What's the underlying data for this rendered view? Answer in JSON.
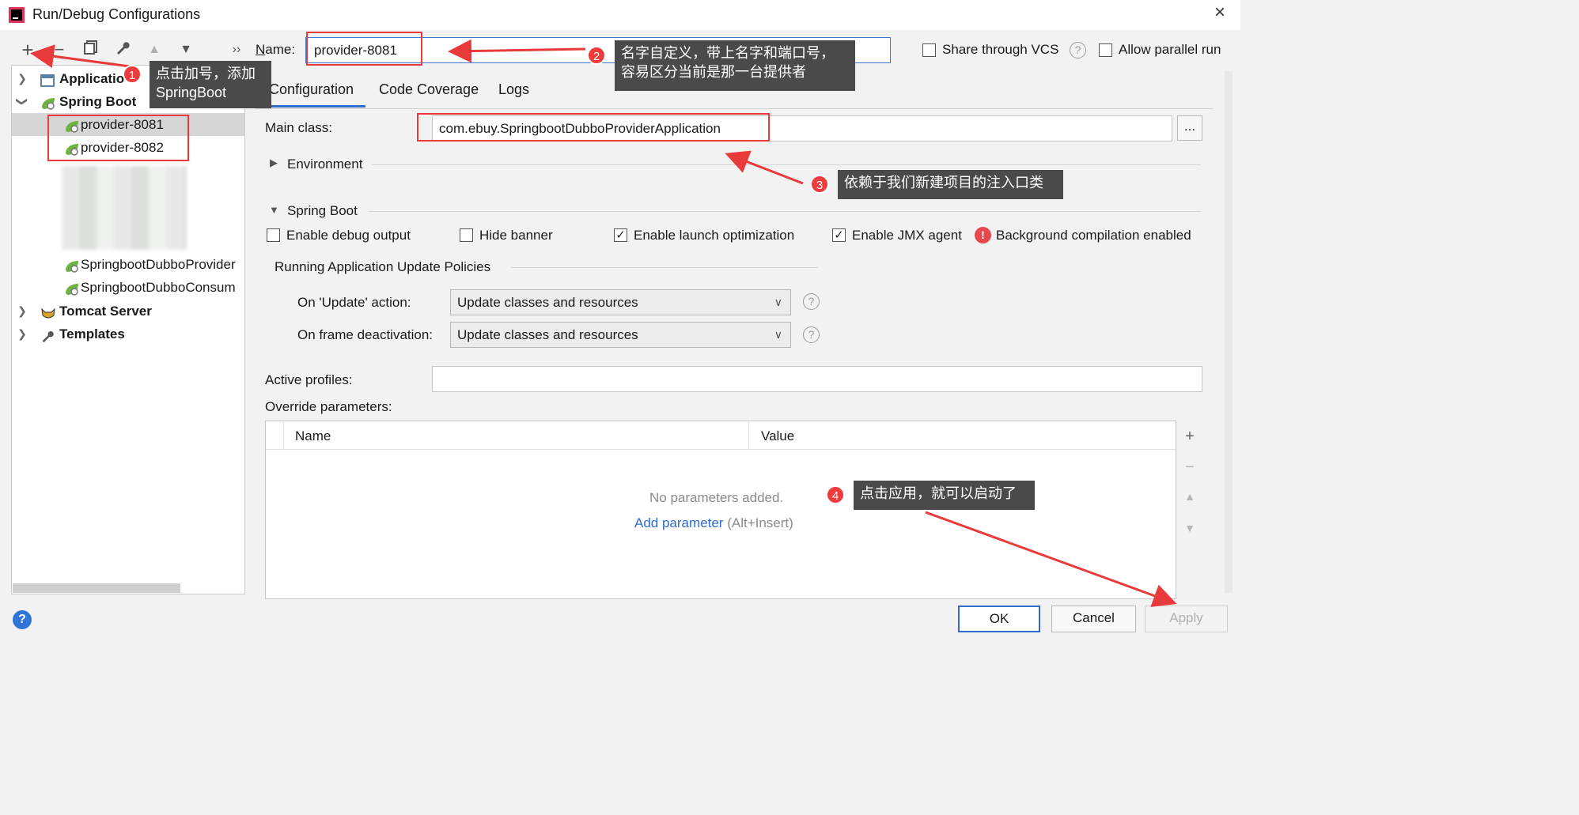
{
  "window": {
    "title": "Run/Debug Configurations",
    "close_label": "×"
  },
  "toolbar": {
    "add_label": "+",
    "remove_label": "−",
    "copy_label": "⧉",
    "edit_label": "🔧",
    "up_label": "▲",
    "down_label": "▼",
    "more_label": "››"
  },
  "tree": {
    "application_label": "Applicatio",
    "spring_boot_label": "Spring Boot",
    "items": [
      {
        "label": "provider-8081",
        "selected": true
      },
      {
        "label": "provider-8082",
        "selected": false
      },
      {
        "label": "SpringbootDubboProvider",
        "selected": false
      },
      {
        "label": "SpringbootDubboConsum",
        "selected": false
      }
    ],
    "tomcat_label": "Tomcat Server",
    "templates_label": "Templates"
  },
  "config": {
    "name_label": "Name:",
    "name_value": "provider-8081",
    "share_vcs_label": "Share through VCS",
    "allow_parallel_label": "Allow parallel run",
    "help_mark": "?",
    "tabs": [
      {
        "label": "Configuration",
        "active": true
      },
      {
        "label": "Code Coverage",
        "active": false
      },
      {
        "label": "Logs",
        "active": false
      }
    ],
    "main_class_label": "Main class:",
    "main_class_value": "com.ebuy.SpringbootDubboProviderApplication",
    "browse_label": "...",
    "environment_label": "Environment",
    "spring_boot_section": "Spring Boot",
    "checks": [
      {
        "label": "Enable debug output",
        "checked": false
      },
      {
        "label": "Hide banner",
        "checked": false
      },
      {
        "label": "Enable launch optimization",
        "checked": true
      },
      {
        "label": "Enable JMX agent",
        "checked": true
      }
    ],
    "warning_text": "Background compilation enabled",
    "policies_label": "Running Application Update Policies",
    "on_update_label": "On 'Update' action:",
    "on_update_value": "Update classes and resources",
    "on_frame_label": "On frame deactivation:",
    "on_frame_value": "Update classes and resources",
    "active_profiles_label": "Active profiles:",
    "override_label": "Override parameters:",
    "table_headers": [
      "Name",
      "Value"
    ],
    "empty_text": "No parameters added.",
    "add_param_label": "Add parameter",
    "add_param_hint": "(Alt+Insert)"
  },
  "side_tools": {
    "add": "+",
    "remove": "−",
    "up": "▲",
    "down": "▼"
  },
  "buttons": {
    "ok": "OK",
    "cancel": "Cancel",
    "apply": "Apply",
    "help": "?"
  },
  "annotations": [
    {
      "num": "1",
      "text_line1": "点击加号，添加",
      "text_line2": "SpringBoot"
    },
    {
      "num": "2",
      "text_line1": "名字自定义，带上名字和端口号，",
      "text_line2": "容易区分当前是那一台提供者"
    },
    {
      "num": "3",
      "text_line1": "依赖于我们新建项目的注入口类"
    },
    {
      "num": "4",
      "text_line1": "点击应用，就可以启动了"
    }
  ],
  "colors": {
    "accent": "#2f6bcb",
    "annotation_red": "#e83a3a",
    "callout_bg": "#4a4a4a",
    "spring_green": "#6db33f"
  }
}
